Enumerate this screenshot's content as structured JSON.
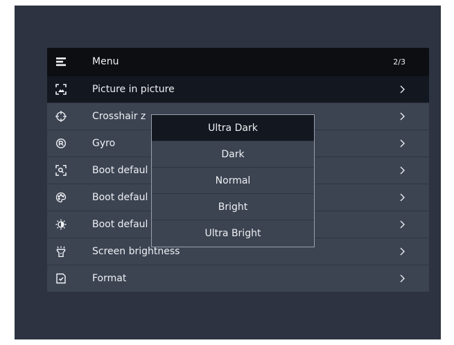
{
  "menu": {
    "title": "Menu",
    "page_indicator": "2/3",
    "items": [
      {
        "label": "Picture in picture",
        "icon": "picture-in-picture-icon",
        "selected": true
      },
      {
        "label": "Crosshair z",
        "icon": "crosshair-icon",
        "selected": false
      },
      {
        "label": "Gyro",
        "icon": "gyro-icon",
        "selected": false
      },
      {
        "label": "Boot defaul",
        "icon": "zoom-focus-icon",
        "selected": false
      },
      {
        "label": "Boot defaul",
        "icon": "palette-icon",
        "selected": false
      },
      {
        "label": "Boot defaul",
        "icon": "contrast-sun-icon",
        "selected": false
      },
      {
        "label": "Screen brightness",
        "icon": "flashlight-icon",
        "selected": false
      },
      {
        "label": "Format",
        "icon": "format-document-icon",
        "selected": false
      }
    ]
  },
  "brightness_popup": {
    "options": [
      "Ultra Dark",
      "Dark",
      "Normal",
      "Bright",
      "Ultra Bright"
    ],
    "highlighted": "Ultra Dark"
  },
  "colors": {
    "background": "#2d3340",
    "row": "#3c4452",
    "header": "#0c0e12",
    "selected_row": "#131720",
    "text": "#eef0f3"
  }
}
